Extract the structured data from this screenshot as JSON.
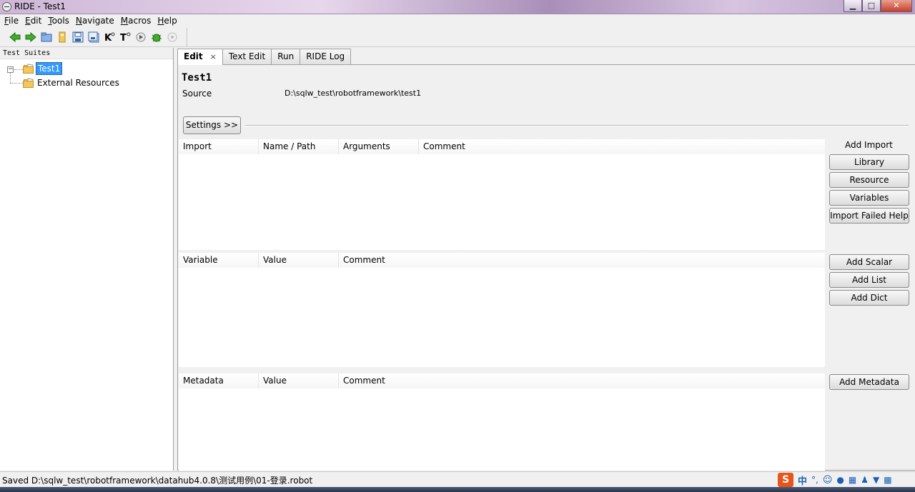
{
  "window": {
    "title": "RIDE - Test1",
    "min": "▁",
    "max": "□",
    "close": "✕"
  },
  "menu": [
    {
      "label": "File",
      "key": "F",
      "rest": "ile"
    },
    {
      "label": "Edit",
      "key": "E",
      "rest": "dit"
    },
    {
      "label": "Tools",
      "key": "T",
      "rest": "ools"
    },
    {
      "label": "Navigate",
      "key": "N",
      "rest": "avigate"
    },
    {
      "label": "Macros",
      "key": "M",
      "rest": "acros"
    },
    {
      "label": "Help",
      "key": "H",
      "rest": "elp"
    }
  ],
  "toolbar": {
    "items": [
      "back-arrow-icon",
      "forward-arrow-icon",
      "open-folder-icon",
      "open-directory-icon",
      "save-icon",
      "save-all-icon",
      "keyword-search-icon",
      "test-search-icon",
      "run-icon",
      "debug-bug-icon",
      "stop-icon"
    ],
    "k_glyph": "K",
    "t_glyph": "T"
  },
  "tree": {
    "header": "Test Suites",
    "expander": "−",
    "root": "Test1",
    "external": "External Resources"
  },
  "tabs": [
    {
      "label": "Edit",
      "active": true,
      "close": "×"
    },
    {
      "label": "Text Edit"
    },
    {
      "label": "Run"
    },
    {
      "label": "RIDE Log"
    }
  ],
  "editor": {
    "suite_name": "Test1",
    "source_label": "Source",
    "source_value": "D:\\sqlw_test\\robotframework\\test1",
    "settings_button": "Settings >>"
  },
  "imports": {
    "columns": [
      "Import",
      "Name / Path",
      "Arguments",
      "Comment"
    ],
    "section_label": "Add Import",
    "buttons": [
      "Library",
      "Resource",
      "Variables",
      "Import Failed Help"
    ]
  },
  "variables": {
    "columns": [
      "Variable",
      "Value",
      "Comment"
    ],
    "buttons": [
      "Add Scalar",
      "Add List",
      "Add Dict"
    ]
  },
  "metadata": {
    "columns": [
      "Metadata",
      "Value",
      "Comment"
    ],
    "buttons": [
      "Add Metadata"
    ]
  },
  "statusbar": {
    "text": "Saved D:\\sqlw_test\\robotframework\\datahub4.0.8\\测试用例\\01-登录.robot",
    "ime_label": "中"
  },
  "colors": {
    "selection": "#3399ff",
    "folder": "#f3c75c",
    "ime_accent": "#e8541a"
  }
}
